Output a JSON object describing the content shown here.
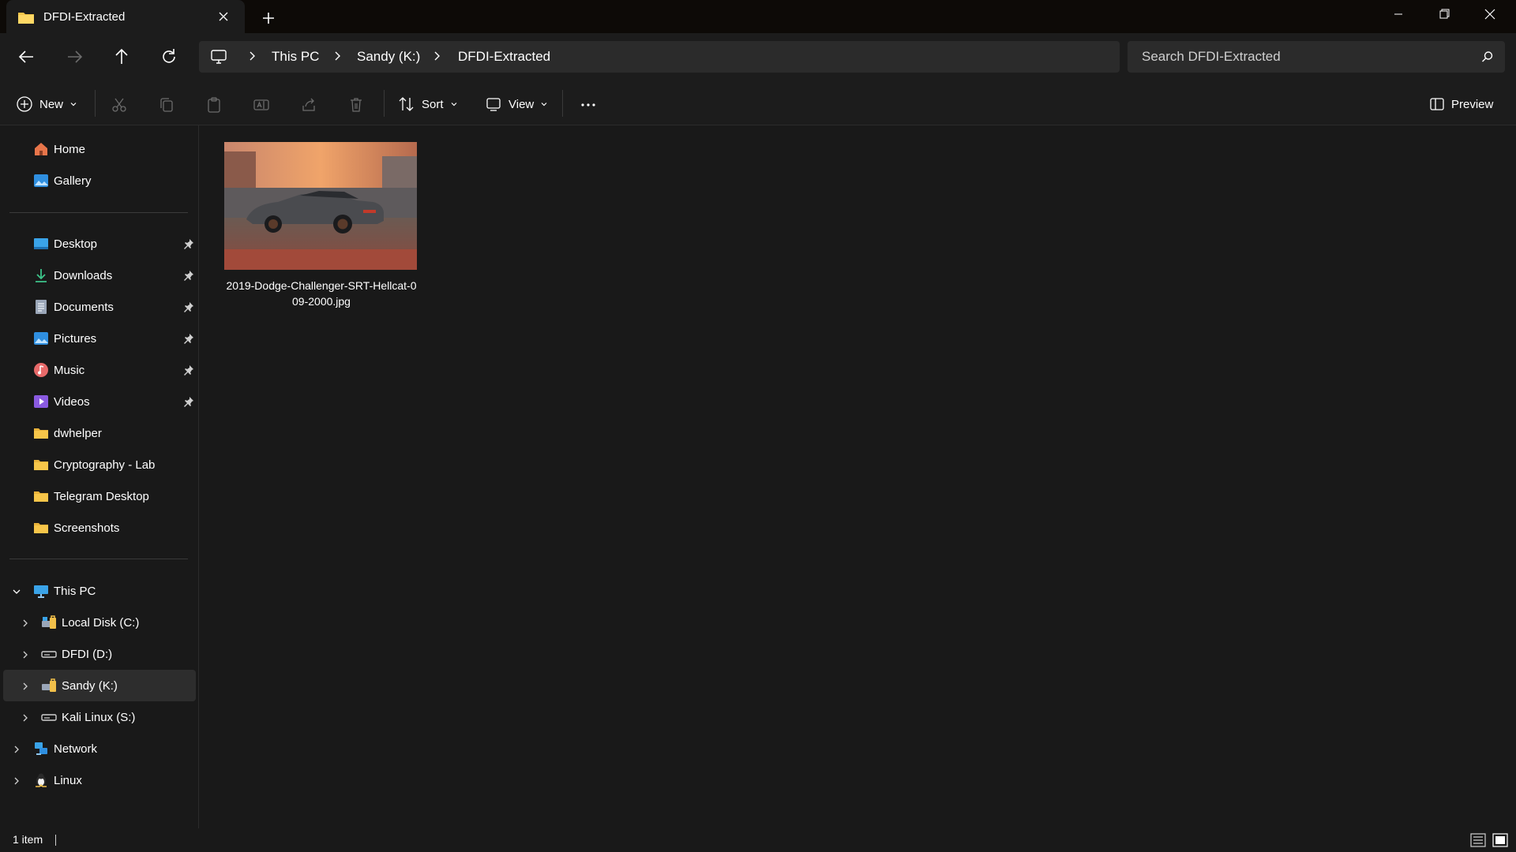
{
  "colors": {
    "accent": "#4cc2ff",
    "folder": "#f7c64a",
    "bg": "#191919",
    "panel": "#1c1c1c",
    "selected": "#2d2d2d"
  },
  "window": {
    "tab_title": "DFDI-Extracted",
    "tab_icon": "folder-icon",
    "new_tab_icon": "plus-icon",
    "controls": [
      "minimize-icon",
      "restore-icon",
      "close-icon"
    ]
  },
  "address": {
    "crumbs": [
      "This PC",
      "Sandy (K:)",
      "DFDI-Extracted"
    ],
    "search_placeholder": "Search DFDI-Extracted"
  },
  "commandbar": {
    "new_label": "New",
    "sort_label": "Sort",
    "view_label": "View",
    "preview_label": "Preview",
    "icons": [
      "cut-icon",
      "copy-icon",
      "paste-icon",
      "rename-icon",
      "share-icon",
      "delete-icon",
      "more-icon"
    ]
  },
  "sidebar": {
    "top": [
      {
        "label": "Home",
        "icon": "home-icon"
      },
      {
        "label": "Gallery",
        "icon": "gallery-icon"
      }
    ],
    "quick": [
      {
        "label": "Desktop",
        "icon": "desktop-icon",
        "pinned": true
      },
      {
        "label": "Downloads",
        "icon": "download-icon",
        "pinned": true
      },
      {
        "label": "Documents",
        "icon": "documents-icon",
        "pinned": true
      },
      {
        "label": "Pictures",
        "icon": "pictures-icon",
        "pinned": true
      },
      {
        "label": "Music",
        "icon": "music-icon",
        "pinned": true
      },
      {
        "label": "Videos",
        "icon": "videos-icon",
        "pinned": true
      },
      {
        "label": "dwhelper",
        "icon": "folder-icon",
        "pinned": false
      },
      {
        "label": "Cryptography - Lab",
        "icon": "folder-icon",
        "pinned": false
      },
      {
        "label": "Telegram Desktop",
        "icon": "folder-icon",
        "pinned": false
      },
      {
        "label": "Screenshots",
        "icon": "folder-icon",
        "pinned": false
      }
    ],
    "this_pc": {
      "label": "This PC",
      "icon": "computer-icon",
      "expanded": true
    },
    "drives": [
      {
        "label": "Local Disk (C:)",
        "icon": "locked-drive-icon",
        "selected": false
      },
      {
        "label": "DFDI (D:)",
        "icon": "drive-icon",
        "selected": false
      },
      {
        "label": "Sandy (K:)",
        "icon": "locked-drive-icon",
        "selected": true
      },
      {
        "label": "Kali Linux (S:)",
        "icon": "drive-icon",
        "selected": false
      }
    ],
    "bottom": [
      {
        "label": "Network",
        "icon": "network-icon"
      },
      {
        "label": "Linux",
        "icon": "linux-icon"
      }
    ]
  },
  "files": [
    {
      "name": "2019-Dodge-Challenger-SRT-Hellcat-009-2000.jpg",
      "name_line1": "2019-Dodge-Challenger-SRT-Hellcat-0",
      "name_line2": "09-2000.jpg",
      "thumbnail": "car-photo"
    }
  ],
  "status": {
    "count": "1 item",
    "views": [
      "details-view-icon",
      "tiles-view-icon"
    ]
  }
}
